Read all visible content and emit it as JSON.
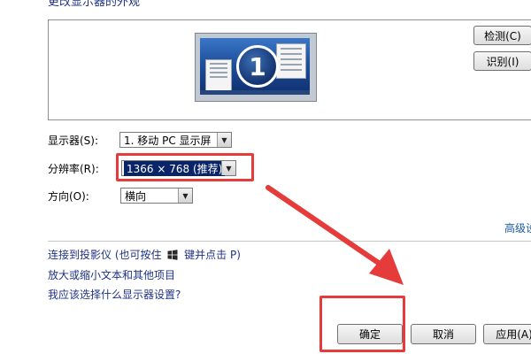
{
  "heading": "更改显示器的外观",
  "preview": {
    "monitor_number": "1"
  },
  "buttons": {
    "detect": "检测(C)",
    "identify": "识别(I)",
    "ok": "确定",
    "cancel": "取消",
    "apply": "应用(A)"
  },
  "form": {
    "display_label": "显示器(S):",
    "display_value": "1. 移动 PC 显示屏",
    "resolution_label": "分辨率(R):",
    "resolution_value": "1366 × 768 (推荐)",
    "orientation_label": "方向(O):",
    "orientation_value": "横向"
  },
  "advanced_link": "高级设置",
  "links": {
    "projector_prefix": "连接到投影仪 (也可按住",
    "projector_suffix": "键并点击 P)",
    "text_size": "放大或缩小文本和其他项目",
    "which_settings": "我应该选择什么显示器设置?"
  },
  "colors": {
    "annotation": "#e53b3b",
    "link": "#1e3287"
  },
  "icons": [
    "windows-logo-icon",
    "chevron-down-icon",
    "annotation-arrow-icon"
  ]
}
